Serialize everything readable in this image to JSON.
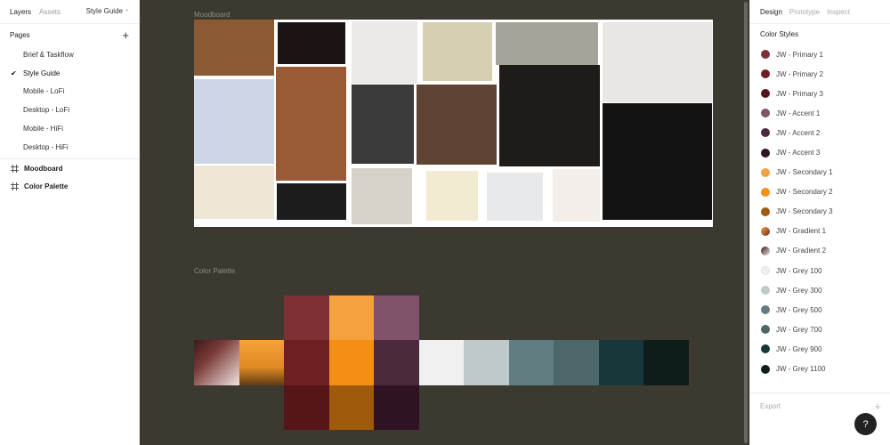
{
  "left_panel": {
    "tabs": [
      "Layers",
      "Assets"
    ],
    "current_page": "Style Guide",
    "pages_label": "Pages",
    "pages": [
      "Brief & Taskflow",
      "Style Guide",
      "Mobile - LoFi",
      "Desktop - LoFi",
      "Mobile - HiFi",
      "Desktop - HiFi"
    ],
    "layers": [
      "Moodboard",
      "Color Palette"
    ]
  },
  "canvas": {
    "moodboard_label": "Moodboard",
    "palette_label": "Color Palette",
    "moodboard_images": [
      {
        "name": "whiskey-bottles-photo",
        "color": "#8a5a32"
      },
      {
        "name": "whiskey-glass-dark-photo",
        "color": "#1b1412"
      },
      {
        "name": "fashion-web-layout",
        "color": "#eceae6"
      },
      {
        "name": "green-envelope-card",
        "color": "#d7cfb2"
      },
      {
        "name": "woman-street-photo",
        "color": "#a6a398"
      },
      {
        "name": "burger-app-mockup",
        "color": "#e9e7e3"
      },
      {
        "name": "sneaker-shop-ui",
        "color": "#cdd6e6"
      },
      {
        "name": "woman-auburn-hair-photo",
        "color": "#9a5a35"
      },
      {
        "name": "glass-bottle-photo",
        "color": "#3b3b3b"
      },
      {
        "name": "woman-portrait-photo",
        "color": "#5f4434"
      },
      {
        "name": "dark-whiskey-web-pages",
        "color": "#1f1b18"
      },
      {
        "name": "whiskey-box-dark-photo",
        "color": "#131313"
      },
      {
        "name": "cocktail-glasses-photo",
        "color": "#efe7d6"
      },
      {
        "name": "rye-whiskey-script-label",
        "color": "#1c1c1c"
      },
      {
        "name": "scotch-bottle-photo",
        "color": "#d7d2c8"
      },
      {
        "name": "teal-chair-photo",
        "color": "#f3ead2"
      },
      {
        "name": "orange-chair-photo",
        "color": "#e7e9ea"
      },
      {
        "name": "rust-chair-photo",
        "color": "#f4eeea"
      }
    ],
    "palette_upper": [
      "#7d3135",
      "#f3a23f",
      "#7f536a"
    ],
    "palette_middle": [
      {
        "name": "gradient-1",
        "color": "#6b2a28"
      },
      {
        "name": "gradient-2",
        "color": "#f5a238"
      },
      {
        "name": "primary-2",
        "color": "#6e1f22"
      },
      {
        "name": "secondary-2",
        "color": "#f48f16"
      },
      {
        "name": "accent-2",
        "color": "#4b2a3b"
      },
      {
        "name": "grey-100",
        "color": "#f0f0f0"
      },
      {
        "name": "grey-300",
        "color": "#bdc9cb"
      },
      {
        "name": "grey-500",
        "color": "#617d82"
      },
      {
        "name": "grey-700",
        "color": "#4c666a"
      },
      {
        "name": "grey-900",
        "color": "#17373a"
      },
      {
        "name": "grey-1100",
        "color": "#0f1c1c"
      }
    ],
    "palette_lower": [
      "#561619",
      "#9f5a0c",
      "#2f1322"
    ]
  },
  "right_panel": {
    "tabs": [
      "Design",
      "Prototype",
      "Inspect"
    ],
    "section_title": "Color Styles",
    "styles": [
      {
        "label": "JW - Primary 1",
        "color": "#7d3135"
      },
      {
        "label": "JW - Primary 2",
        "color": "#6e1f22"
      },
      {
        "label": "JW - Primary 3",
        "color": "#561619"
      },
      {
        "label": "JW - Accent 1",
        "color": "#7f536a"
      },
      {
        "label": "JW - Accent 2",
        "color": "#4b2a3b"
      },
      {
        "label": "JW - Accent 3",
        "color": "#2f1322"
      },
      {
        "label": "JW - Secondary 1",
        "color": "#f3a23f"
      },
      {
        "label": "JW - Secondary 2",
        "color": "#f48f16"
      },
      {
        "label": "JW - Secondary 3",
        "color": "#9f5a0c"
      },
      {
        "label": "JW - Gradient 1",
        "color": "#b86a2e"
      },
      {
        "label": "JW - Gradient 2",
        "color": "#7a4a44"
      },
      {
        "label": "JW - Grey 100",
        "color": "#f0f0f0"
      },
      {
        "label": "JW - Grey 300",
        "color": "#bdc9cb"
      },
      {
        "label": "JW - Grey 500",
        "color": "#617d82"
      },
      {
        "label": "JW - Grey 700",
        "color": "#4c666a"
      },
      {
        "label": "JW - Grey 900",
        "color": "#17373a"
      },
      {
        "label": "JW - Grey 1100",
        "color": "#0f1c1c"
      }
    ],
    "export_label": "Export",
    "help_label": "?"
  }
}
